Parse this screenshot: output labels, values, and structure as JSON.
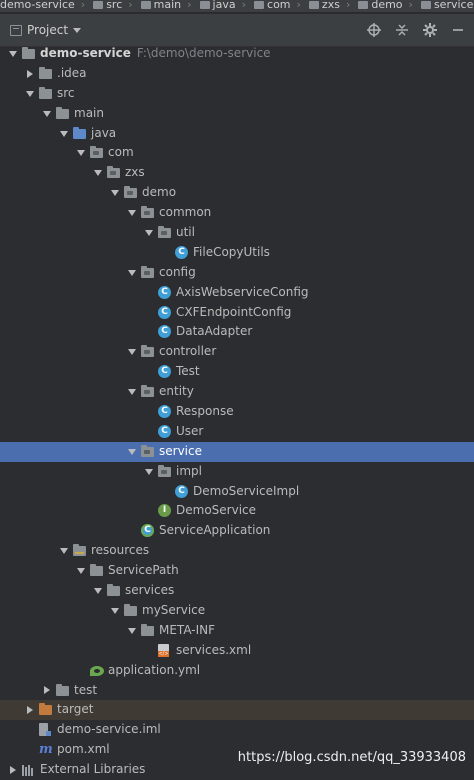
{
  "breadcrumb": [
    "demo-service",
    "src",
    "main",
    "java",
    "com",
    "zxs",
    "demo",
    "service"
  ],
  "header": {
    "title": "Project",
    "icons": [
      "locate-icon",
      "collapse-all-icon",
      "gear-icon",
      "hide-icon"
    ]
  },
  "tree": [
    {
      "label": "demo-service",
      "path": "F:\\demo\\demo-service",
      "icon": "module-folder-icon",
      "expanded": true,
      "depth": 0,
      "bold": true
    },
    {
      "label": ".idea",
      "icon": "folder-icon",
      "expanded": false,
      "depth": 1
    },
    {
      "label": "src",
      "icon": "folder-icon",
      "expanded": true,
      "depth": 1
    },
    {
      "label": "main",
      "icon": "folder-icon",
      "expanded": true,
      "depth": 2
    },
    {
      "label": "java",
      "icon": "source-folder-icon",
      "expanded": true,
      "depth": 3
    },
    {
      "label": "com",
      "icon": "package-icon",
      "expanded": true,
      "depth": 4
    },
    {
      "label": "zxs",
      "icon": "package-icon",
      "expanded": true,
      "depth": 5
    },
    {
      "label": "demo",
      "icon": "package-icon",
      "expanded": true,
      "depth": 6
    },
    {
      "label": "common",
      "icon": "package-icon",
      "expanded": true,
      "depth": 7
    },
    {
      "label": "util",
      "icon": "package-icon",
      "expanded": true,
      "depth": 8
    },
    {
      "label": "FileCopyUtils",
      "icon": "class-icon",
      "depth": 9
    },
    {
      "label": "config",
      "icon": "package-icon",
      "expanded": true,
      "depth": 7
    },
    {
      "label": "AxisWebserviceConfig",
      "icon": "class-icon",
      "depth": 8
    },
    {
      "label": "CXFEndpointConfig",
      "icon": "class-icon",
      "depth": 8
    },
    {
      "label": "DataAdapter",
      "icon": "class-icon",
      "depth": 8
    },
    {
      "label": "controller",
      "icon": "package-icon",
      "expanded": true,
      "depth": 7
    },
    {
      "label": "Test",
      "icon": "class-icon",
      "depth": 8
    },
    {
      "label": "entity",
      "icon": "package-icon",
      "expanded": true,
      "depth": 7
    },
    {
      "label": "Response",
      "icon": "class-icon",
      "depth": 8
    },
    {
      "label": "User",
      "icon": "class-icon",
      "depth": 8
    },
    {
      "label": "service",
      "icon": "package-icon",
      "expanded": true,
      "depth": 7,
      "selected": true
    },
    {
      "label": "impl",
      "icon": "package-icon",
      "expanded": true,
      "depth": 8
    },
    {
      "label": "DemoServiceImpl",
      "icon": "class-icon",
      "depth": 9
    },
    {
      "label": "DemoService",
      "icon": "interface-icon",
      "depth": 8
    },
    {
      "label": "ServiceApplication",
      "icon": "spring-boot-class-icon",
      "depth": 7
    },
    {
      "label": "resources",
      "icon": "resources-folder-icon",
      "expanded": true,
      "depth": 3
    },
    {
      "label": "ServicePath",
      "icon": "folder-icon",
      "expanded": true,
      "depth": 4
    },
    {
      "label": "services",
      "icon": "folder-icon",
      "expanded": true,
      "depth": 5
    },
    {
      "label": "myService",
      "icon": "folder-icon",
      "expanded": true,
      "depth": 6
    },
    {
      "label": "META-INF",
      "icon": "folder-icon",
      "expanded": true,
      "depth": 7
    },
    {
      "label": "services.xml",
      "icon": "xml-file-icon",
      "depth": 8
    },
    {
      "label": "application.yml",
      "icon": "yml-file-icon",
      "depth": 4
    },
    {
      "label": "test",
      "icon": "folder-icon",
      "expanded": false,
      "depth": 2
    },
    {
      "label": "target",
      "icon": "excluded-folder-icon",
      "expanded": false,
      "depth": 1,
      "highlight": true
    },
    {
      "label": "demo-service.iml",
      "icon": "iml-file-icon",
      "depth": 1
    },
    {
      "label": "pom.xml",
      "icon": "maven-icon",
      "depth": 1
    },
    {
      "label": "External Libraries",
      "icon": "libraries-icon",
      "expanded": false,
      "depth": 0
    }
  ],
  "watermark": "https://blog.csdn.net/qq_33933408",
  "colors": {
    "selection": "#4b6eaf",
    "background": "#2b2d30",
    "class_icon": "#3f9fd6"
  }
}
